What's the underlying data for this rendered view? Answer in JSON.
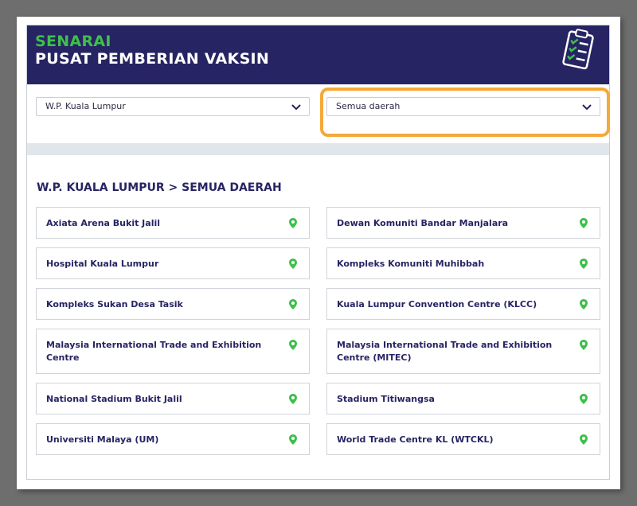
{
  "banner": {
    "title_line1": "SENARAI",
    "title_line2": "PUSAT PEMBERIAN VAKSIN",
    "icon": "clipboard-checklist-icon"
  },
  "filters": {
    "state": "W.P. Kuala Lumpur",
    "district": "Semua daerah"
  },
  "results_heading": "W.P. KUALA LUMPUR > SEMUA DAERAH",
  "centres": [
    "Axiata Arena Bukit Jalil",
    "Dewan Komuniti Bandar Manjalara",
    "Hospital Kuala Lumpur",
    "Kompleks Komuniti Muhibbah",
    "Kompleks Sukan Desa Tasik",
    "Kuala Lumpur Convention Centre (KLCC)",
    "Malaysia International Trade and Exhibition Centre",
    "Malaysia International Trade and Exhibition Centre (MITEC)",
    "National Stadium Bukit Jalil",
    "Stadium Titiwangsa",
    "Universiti Malaya (UM)",
    "World Trade Centre KL (WTCKL)"
  ],
  "colors": {
    "banner_bg": "#272463",
    "accent_green": "#3fbf4c",
    "highlight_orange": "#f5a938"
  }
}
